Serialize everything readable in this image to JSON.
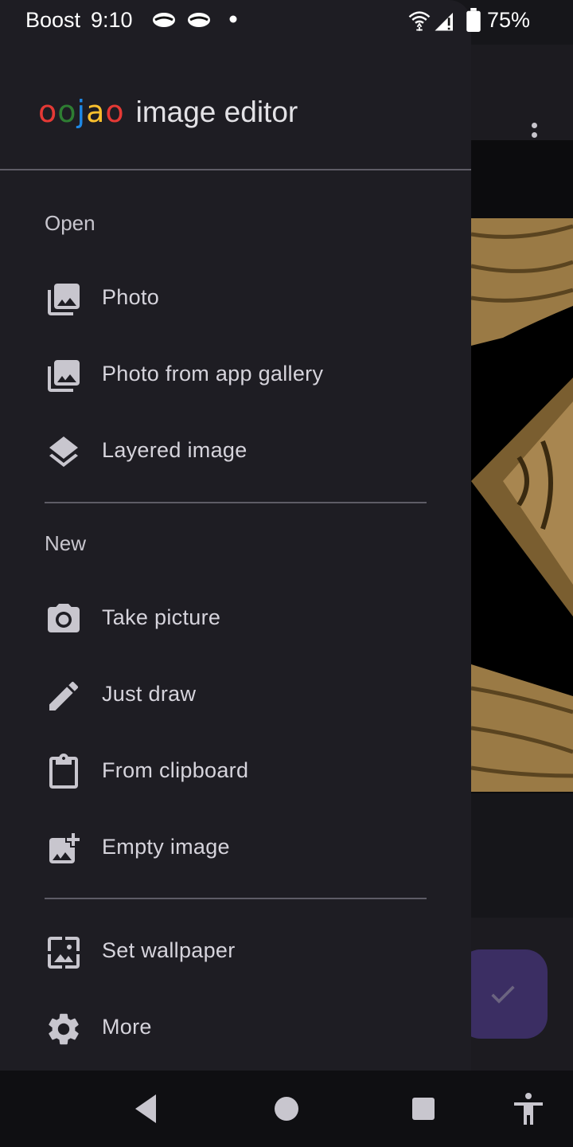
{
  "status_bar": {
    "carrier": "Boost",
    "time": "9:10",
    "battery": "75%"
  },
  "drawer": {
    "logo_letters": [
      {
        "ch": "o",
        "color": "#e53935"
      },
      {
        "ch": "o",
        "color": "#2e7d32"
      },
      {
        "ch": "j",
        "color": "#1e88e5"
      },
      {
        "ch": "a",
        "color": "#fbc02d"
      },
      {
        "ch": "o",
        "color": "#e53935"
      }
    ],
    "app_title": "image editor",
    "sections": {
      "open": "Open",
      "new": "New"
    },
    "items": {
      "photo": {
        "label": "Photo",
        "icon": "photo-library-icon"
      },
      "photo_gallery": {
        "label": "Photo from app gallery",
        "icon": "photo-library-icon"
      },
      "layered": {
        "label": "Layered image",
        "icon": "layers-icon"
      },
      "take_picture": {
        "label": "Take picture",
        "icon": "camera-icon"
      },
      "just_draw": {
        "label": "Just draw",
        "icon": "pencil-icon"
      },
      "clipboard": {
        "label": "From clipboard",
        "icon": "clipboard-icon"
      },
      "empty_image": {
        "label": "Empty image",
        "icon": "add-photo-icon"
      },
      "wallpaper": {
        "label": "Set wallpaper",
        "icon": "wallpaper-icon"
      },
      "more": {
        "label": "More",
        "icon": "gear-icon"
      }
    }
  },
  "colors": {
    "drawer_bg": "#1e1d23",
    "icon": "#c8c6ce",
    "fab": "#3b2e63"
  }
}
